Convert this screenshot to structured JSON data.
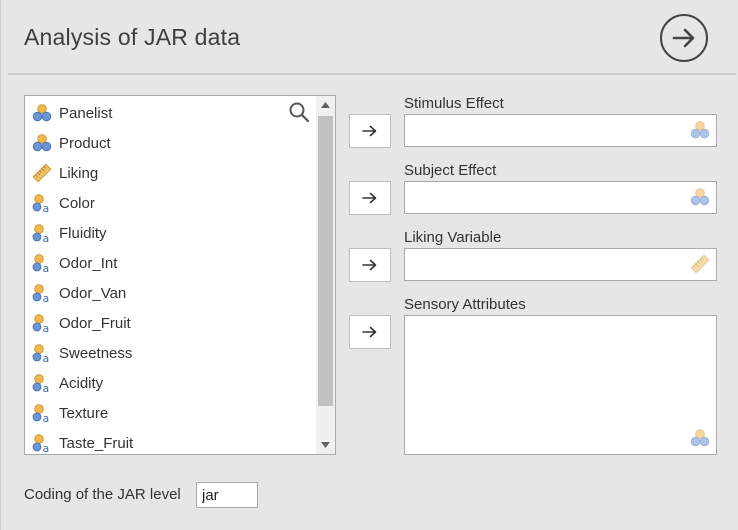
{
  "header": {
    "title": "Analysis of JAR data",
    "go_icon": "arrow-right-circle-icon"
  },
  "variables": {
    "search_icon": "search-icon",
    "items": [
      {
        "label": "Panelist",
        "icon": "nominal-factor-icon"
      },
      {
        "label": "Product",
        "icon": "nominal-factor-icon"
      },
      {
        "label": "Liking",
        "icon": "continuous-ruler-icon"
      },
      {
        "label": "Color",
        "icon": "nominal-text-icon"
      },
      {
        "label": "Fluidity",
        "icon": "nominal-text-icon"
      },
      {
        "label": "Odor_Int",
        "icon": "nominal-text-icon"
      },
      {
        "label": "Odor_Van",
        "icon": "nominal-text-icon"
      },
      {
        "label": "Odor_Fruit",
        "icon": "nominal-text-icon"
      },
      {
        "label": "Sweetness",
        "icon": "nominal-text-icon"
      },
      {
        "label": "Acidity",
        "icon": "nominal-text-icon"
      },
      {
        "label": "Texture",
        "icon": "nominal-text-icon"
      },
      {
        "label": "Taste_Fruit",
        "icon": "nominal-text-icon"
      }
    ]
  },
  "targets": [
    {
      "label": "Stimulus Effect",
      "icon": "nominal-factor-icon"
    },
    {
      "label": "Subject Effect",
      "icon": "nominal-factor-icon"
    },
    {
      "label": "Liking Variable",
      "icon": "continuous-ruler-icon"
    },
    {
      "label": "Sensory Attributes",
      "icon": "nominal-factor-icon"
    }
  ],
  "arrow_button": {
    "icon": "arrow-right-icon"
  },
  "coding": {
    "label": "Coding of the JAR level",
    "value": "jar"
  },
  "colors": {
    "background": "#e6e6e6",
    "icon_orange": "#f5b84c",
    "icon_blue": "#6b95d6",
    "ruler": "#f2c46a"
  }
}
